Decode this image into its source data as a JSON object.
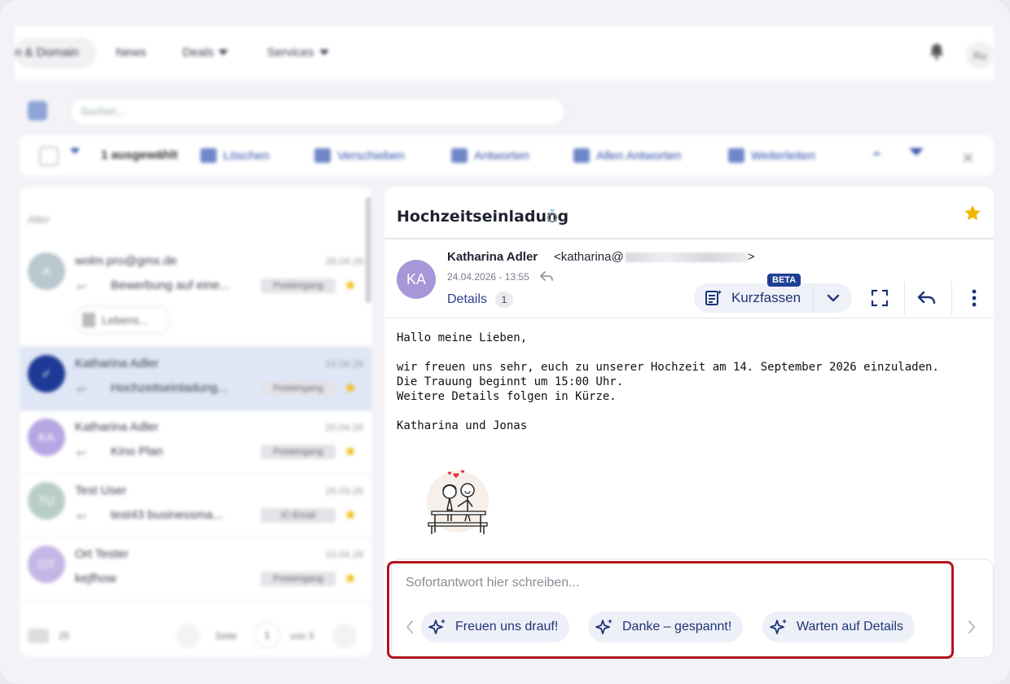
{
  "topnav": {
    "items": [
      "n & Domain",
      "News",
      "Deals",
      "Services"
    ],
    "avatar_initials": "Ru"
  },
  "search": {
    "placeholder": "Suchen..."
  },
  "toolbar": {
    "selected": "1 ausgewählt",
    "delete": "Löschen",
    "move": "Verschieben",
    "reply": "Antworten",
    "reply_all": "Allen Antworten",
    "forward": "Weiterleiten"
  },
  "list": {
    "filter_label": "Alter",
    "rows": [
      {
        "from": "wolm.pro@gmx.de",
        "date": "28.04.26",
        "initial": "A",
        "subject": "Bewerbung auf eine...",
        "tag": "Posteingang",
        "avatar_color": "#b9c7cf"
      },
      {
        "from": "Katharina Adler",
        "date": "24.04.26",
        "initial": "",
        "subject": "Hochzeitseinladung...",
        "tag": "Posteingang",
        "avatar_color": "#1e3a96"
      },
      {
        "from": "Katharina Adler",
        "date": "20.04.26",
        "initial": "KA",
        "subject": "Kino Plan",
        "tag": "Posteingang",
        "avatar_color": "#b7a6e3"
      },
      {
        "from": "Test User",
        "date": "26.03.26",
        "initial": "TU",
        "subject": "test43 businessma...",
        "tag": "IC-Email",
        "avatar_color": "#b9cdc8"
      },
      {
        "from": "Ort Tester",
        "date": "10.04.26",
        "initial": "OT",
        "subject": "kejfhow",
        "tag": "Posteingang",
        "avatar_color": "#c5b6e6"
      }
    ],
    "attachment": "Lebens...",
    "pager": {
      "count": "25",
      "page_label": "Seite",
      "page": "1",
      "of": "von 3"
    }
  },
  "mail": {
    "subject": "Hochzeitseinladung",
    "sender_name": "Katharina Adler",
    "sender_address_prefix": "<katharina@",
    "sender_address_suffix": ">",
    "avatar_initials": "KA",
    "date": "24.04.2026 - 13:55",
    "details_label": "Details",
    "details_count": "1",
    "summarize_label": "Kurzfassen",
    "beta_label": "BETA",
    "body": {
      "greeting": "Hallo meine Lieben,",
      "line1": "wir freuen uns sehr, euch zu unserer Hochzeit am 14. September 2026 einzuladen.",
      "line2": "Die Trauung beginnt um 15:00 Uhr.",
      "line3": "Weitere Details folgen in Kürze.",
      "signature": "Katharina und Jonas"
    }
  },
  "quick_reply": {
    "placeholder": "Sofortantwort hier schreiben...",
    "suggestions": [
      "Freuen uns drauf!",
      "Danke – gespannt!",
      "Warten auf Details"
    ]
  },
  "colors": {
    "accent": "#1e3477",
    "highlight_outline": "#b3121c",
    "star": "#f2b600",
    "avatar": "#a996d6"
  }
}
